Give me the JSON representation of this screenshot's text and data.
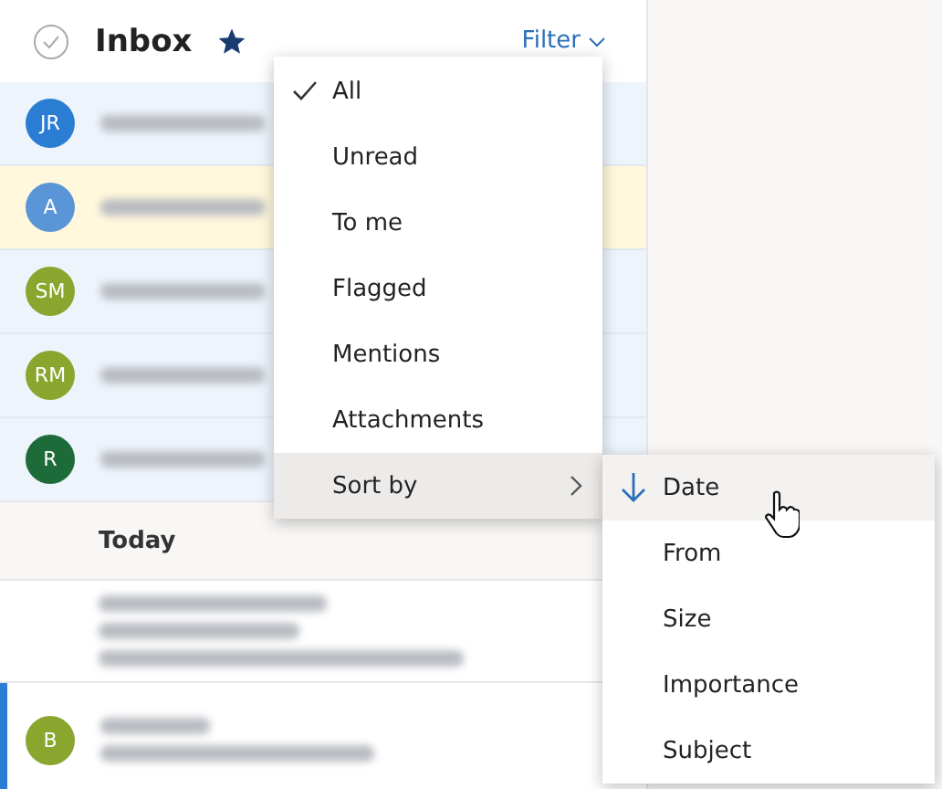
{
  "header": {
    "title": "Inbox",
    "filter_label": "Filter"
  },
  "messages": [
    {
      "initials": "JR",
      "color": "#2b7cd3",
      "kind": "unread"
    },
    {
      "initials": "A",
      "color": "#5a95d8",
      "kind": "pinned"
    },
    {
      "initials": "SM",
      "color": "#8aa62e",
      "kind": "unread"
    },
    {
      "initials": "RM",
      "color": "#8aa62e",
      "kind": "unread"
    },
    {
      "initials": "R",
      "color": "#1e6b3a",
      "kind": "unread"
    },
    {
      "kind": "group",
      "label": "Today"
    },
    {
      "kind": "read"
    },
    {
      "initials": "B",
      "color": "#8aa62e",
      "kind": "selected"
    }
  ],
  "filter_menu": [
    {
      "label": "All",
      "checked": true
    },
    {
      "label": "Unread",
      "checked": false
    },
    {
      "label": "To me",
      "checked": false
    },
    {
      "label": "Flagged",
      "checked": false
    },
    {
      "label": "Mentions",
      "checked": false
    },
    {
      "label": "Attachments",
      "checked": false
    },
    {
      "label": "Sort by",
      "checked": false,
      "kind": "submenu",
      "expanded": true
    }
  ],
  "sort_menu": [
    {
      "label": "Date",
      "selected": true
    },
    {
      "label": "From",
      "selected": false
    },
    {
      "label": "Size",
      "selected": false
    },
    {
      "label": "Importance",
      "selected": false
    },
    {
      "label": "Subject",
      "selected": false
    }
  ]
}
